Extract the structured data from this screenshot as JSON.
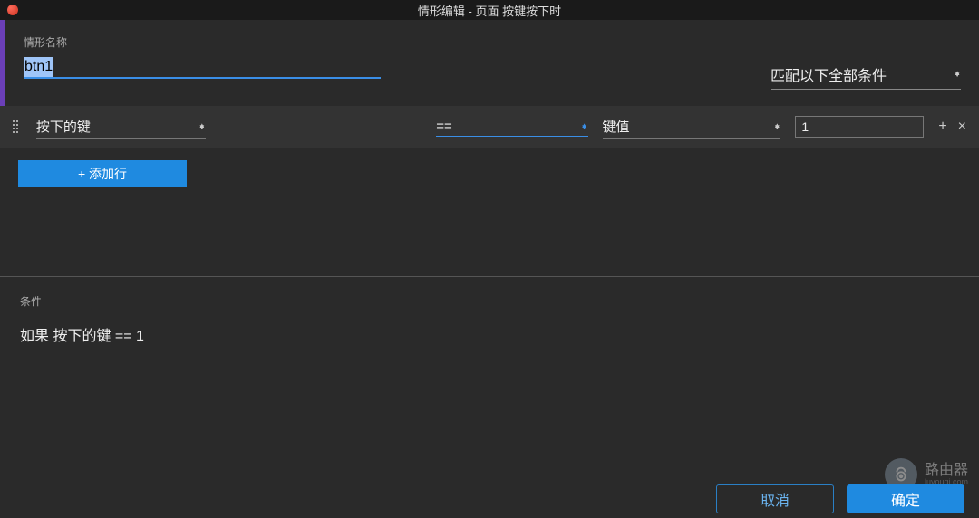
{
  "window": {
    "title": "情形编辑   -   页面 按键按下时"
  },
  "case": {
    "label": "情形名称",
    "name_value": "btn1",
    "match_label": "匹配以下全部条件"
  },
  "row": {
    "field1": "按下的键",
    "operator": "==",
    "field2": "键值",
    "value": "1"
  },
  "buttons": {
    "add_row": "+ 添加行",
    "cancel": "取消",
    "ok": "确定"
  },
  "condition": {
    "label": "条件",
    "expression": "如果 按下的键 == 1"
  },
  "watermark": {
    "text": "路由器",
    "sub": "luyouqi.com"
  }
}
